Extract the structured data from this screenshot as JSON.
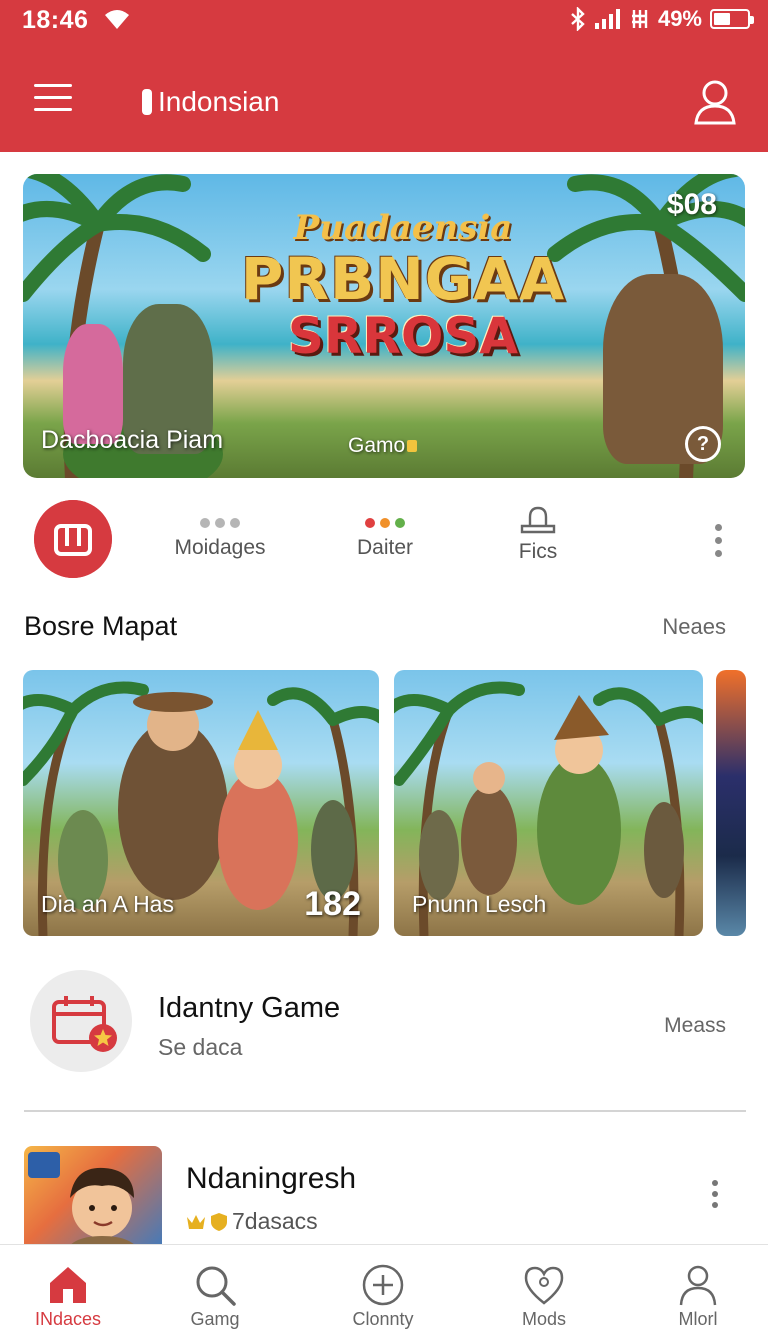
{
  "status_bar": {
    "time": "18:46",
    "battery": "49%"
  },
  "app_bar": {
    "language": "Indonsian"
  },
  "hero": {
    "logo_line1": "Puadaensia",
    "logo_line2": "PRBNGAA",
    "logo_line3": "SRROSA",
    "price": "$08",
    "caption": "Dacboacia Piam",
    "sub": "Gamo"
  },
  "quick_actions": [
    {
      "label": "Moidages"
    },
    {
      "label": "Daiter"
    },
    {
      "label": "Fics"
    }
  ],
  "section": {
    "title": "Bosre Mapat",
    "more": "Neaes"
  },
  "cards": [
    {
      "title": "Dia an A Has",
      "number": "182"
    },
    {
      "title": "Pnunn Lesch"
    }
  ],
  "list_items": [
    {
      "title": "Idantny Game",
      "subtitle": "Se daca",
      "meta": "Meass"
    },
    {
      "title": "Ndaningresh",
      "subtitle": "7dasacs"
    }
  ],
  "bottom_nav": [
    {
      "label": "INdaces",
      "icon": "home-icon",
      "active": true
    },
    {
      "label": "Gamg",
      "icon": "search-icon"
    },
    {
      "label": "Clonnty",
      "icon": "plus-circle-icon"
    },
    {
      "label": "Mods",
      "icon": "heart-icon"
    },
    {
      "label": "Mlorl",
      "icon": "profile-icon"
    }
  ],
  "colors": {
    "brand_red": "#d63a40"
  }
}
